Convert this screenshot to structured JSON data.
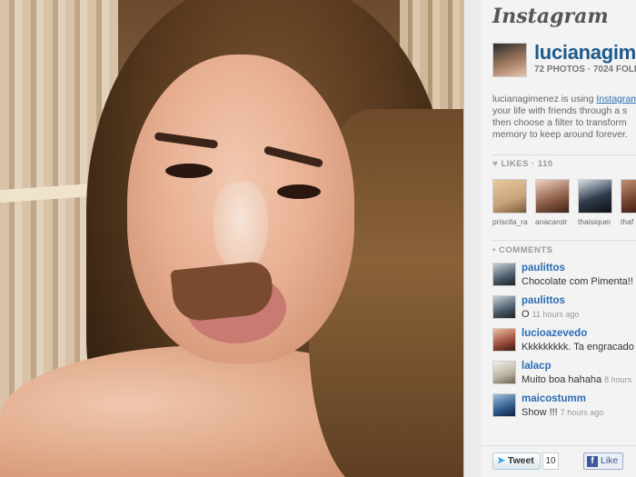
{
  "brand": "Instagram",
  "profile": {
    "username": "lucianagim",
    "stats": "72 PHOTOS · 7024 FOLLO"
  },
  "bio": {
    "line1_prefix": "lucianagimenez is using ",
    "line1_link": "Instagram",
    "line2": "your life with friends through a s",
    "line3": "then choose a filter to transform",
    "line4": "memory to keep around forever."
  },
  "likes": {
    "header": "LIKES · 110",
    "icon": "heart-icon",
    "users": [
      {
        "name": "priscila_ra",
        "color": "#c9a27a"
      },
      {
        "name": "anacarolr",
        "color": "#8a5a44"
      },
      {
        "name": "thaisiquei",
        "color": "#2e3a4a"
      },
      {
        "name": "thaf",
        "color": "#6a3a2a"
      }
    ]
  },
  "comments": {
    "header": "COMMENTS",
    "icon": "speech-bubble-icon",
    "items": [
      {
        "user": "paulittos",
        "text": "Chocolate com Pimenta!!",
        "time": "",
        "color": "#4a5a6a"
      },
      {
        "user": "paulittos",
        "text": "O",
        "time": "11 hours ago",
        "color": "#4a5a6a"
      },
      {
        "user": "lucioazevedo",
        "text": "Kkkkkkkkk. Ta engracado",
        "time": "",
        "color": "#9a4a3a"
      },
      {
        "user": "lalacp",
        "text": "Muito boa hahaha",
        "time": "8 hours",
        "color": "#b8b0a0"
      },
      {
        "user": "maicostumm",
        "text": "Show !!!",
        "time": "7 hours ago",
        "color": "#2f5a8a"
      }
    ]
  },
  "share": {
    "tweet_label": "Tweet",
    "tweet_count": "10",
    "like_label": "Like"
  }
}
